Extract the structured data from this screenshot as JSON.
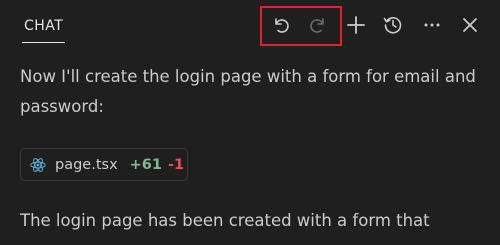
{
  "header": {
    "tab_label": "CHAT",
    "buttons": {
      "undo": "undo-icon",
      "redo": "redo-icon",
      "new": "plus-icon",
      "history": "history-icon",
      "more": "ellipsis-icon",
      "close": "close-icon"
    },
    "highlight_color": "#e5212a"
  },
  "messages": {
    "intro": "Now I'll create the login page with a form for email and password:",
    "outro": "The login page has been created with a form that"
  },
  "file_chip": {
    "name": "page.tsx",
    "added": "+61",
    "removed": "-1",
    "icon": "react-icon",
    "added_color": "#81b88b",
    "removed_color": "#f14c4c"
  }
}
